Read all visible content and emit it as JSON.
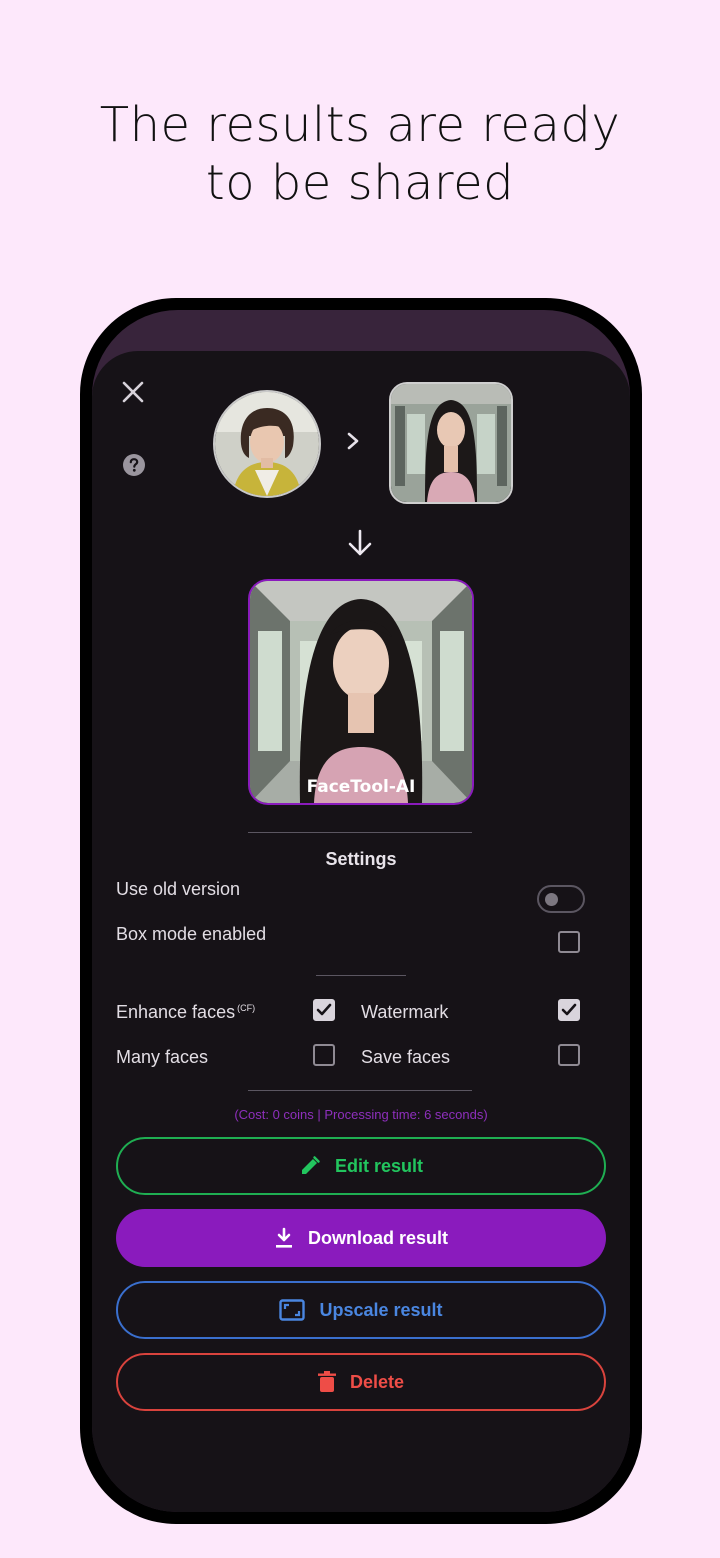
{
  "headline": {
    "line1": "The results are ready",
    "line2": "to be shared"
  },
  "app": {
    "icons": {
      "close": "close-icon",
      "help": "help-circle-icon",
      "next": "chevron-right-icon",
      "down": "arrow-down-icon"
    },
    "watermark_text": "FaceTool-AI",
    "settings": {
      "title": "Settings",
      "use_old_version": {
        "label": "Use old version",
        "enabled": false
      },
      "box_mode": {
        "label": "Box mode enabled",
        "checked": false
      },
      "enhance_faces": {
        "label": "Enhance faces",
        "superscript": "(CF)",
        "checked": true
      },
      "watermark": {
        "label": "Watermark",
        "checked": true
      },
      "many_faces": {
        "label": "Many faces",
        "checked": false
      },
      "save_faces": {
        "label": "Save faces",
        "checked": false
      }
    },
    "cost_text": "(Cost: 0 coins | Processing time: 6 seconds)",
    "buttons": {
      "edit": "Edit result",
      "download": "Download result",
      "upscale": "Upscale result",
      "delete": "Delete"
    }
  },
  "colors": {
    "background": "#fde8fb",
    "accent_purple": "#8a1bbd",
    "edit_green": "#22c55e",
    "upscale_blue": "#4a86e0",
    "delete_red": "#ee4d47"
  }
}
